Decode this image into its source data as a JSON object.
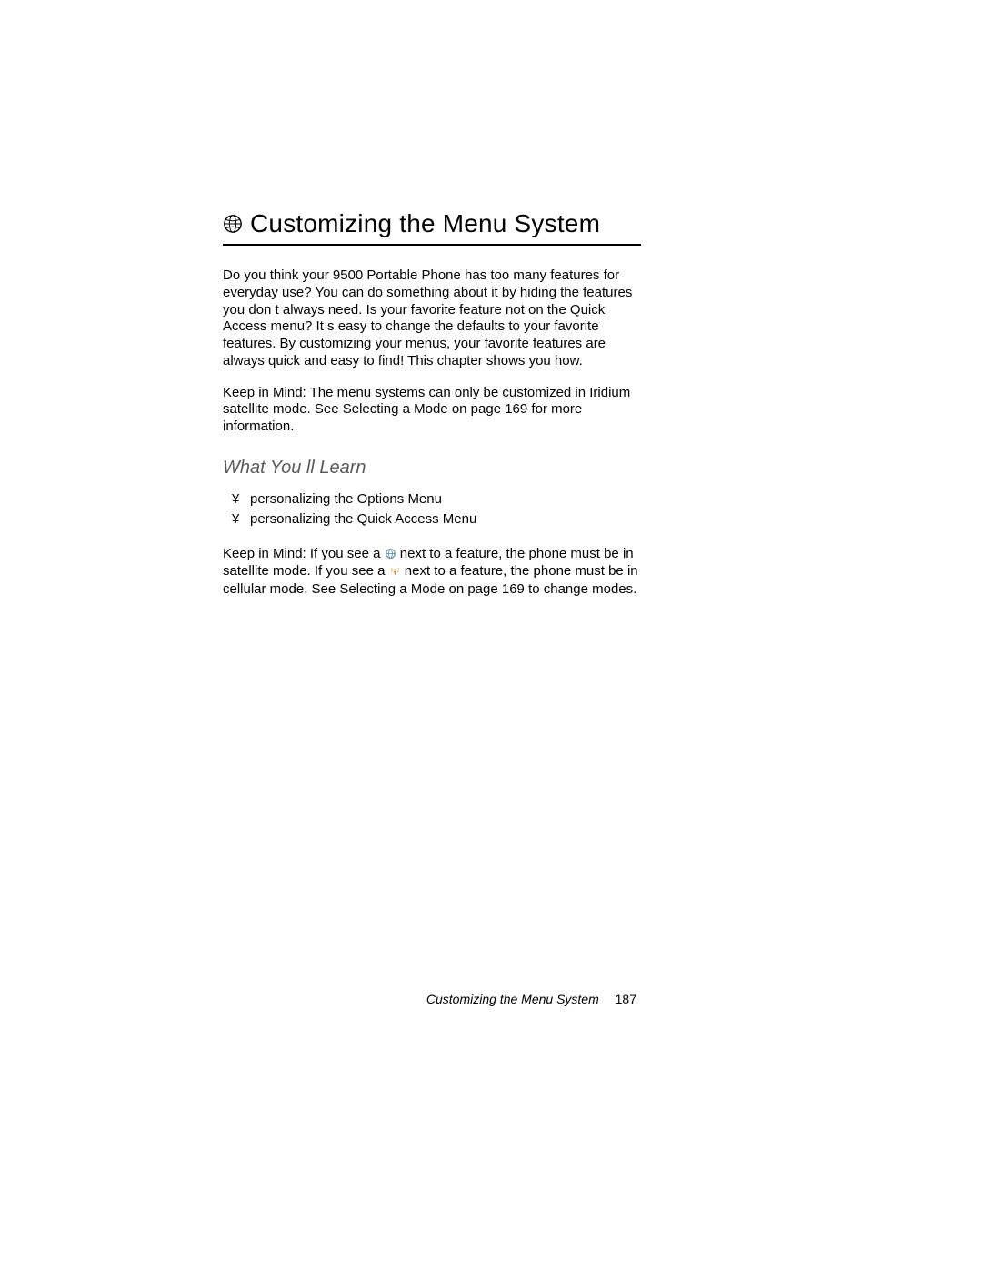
{
  "chapter": {
    "title": "Customizing the Menu System",
    "intro": "Do you think your 9500 Portable Phone has too many features for everyday use? You can do something about it by hiding the features you don t always need. Is your favorite feature not on the Quick Access menu? It s easy to change the defaults to your favorite features. By customizing your menus, your favorite features are always quick and easy to find! This chapter shows you how.",
    "keep_in_mind_1": "Keep in Mind:  The menu systems can only be customized in Iridium satellite mode. See  Selecting a Mode  on page 169 for more information."
  },
  "section": {
    "heading": "What You ll Learn",
    "bullets": [
      "personalizing the Options Menu",
      "personalizing the Quick Access Menu"
    ],
    "note_pre": "Keep in Mind:  If you see a ",
    "note_mid1": " next to a feature, the phone must be in satellite mode. If you see a ",
    "note_mid2": " next to a feature, the phone must be in cellular mode. See  Selecting a Mode  on page 169 to change modes."
  },
  "footer": {
    "title": "Customizing the Menu System",
    "page": "187"
  }
}
